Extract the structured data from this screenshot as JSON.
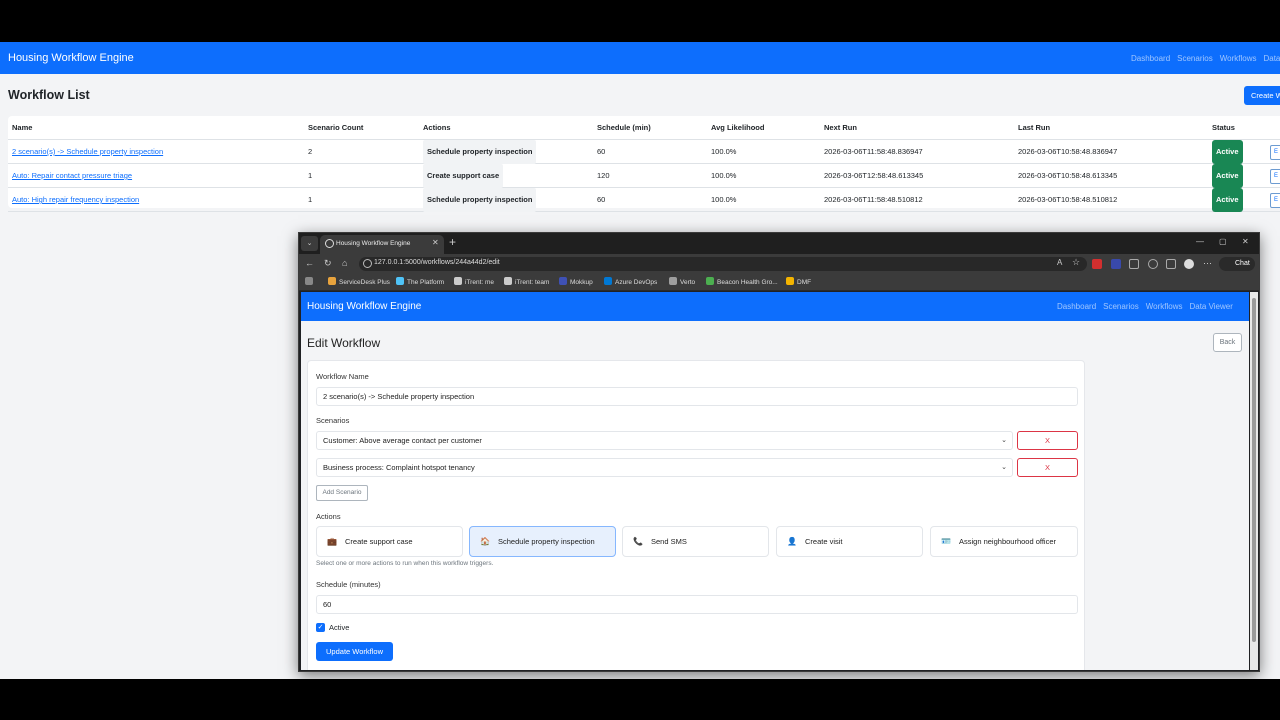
{
  "background_app": {
    "brand": "Housing Workflow Engine",
    "nav": [
      "Dashboard",
      "Scenarios",
      "Workflows",
      "Data"
    ],
    "title": "Workflow List",
    "create_button": "Create W",
    "table": {
      "headers": [
        "Name",
        "Scenario Count",
        "Actions",
        "Schedule (min)",
        "Avg Likelihood",
        "Next Run",
        "Last Run",
        "Status"
      ],
      "rows": [
        {
          "name": "2 scenario(s) -> Schedule property inspection",
          "scenario_count": "2",
          "action": "Schedule property inspection",
          "schedule": "60",
          "likelihood": "100.0%",
          "next_run": "2026-03-06T11:58:48.836947",
          "last_run": "2026-03-06T10:58:48.836947",
          "status": "Active",
          "edit": "E"
        },
        {
          "name": "Auto: Repair contact pressure triage",
          "scenario_count": "1",
          "action": "Create support case",
          "schedule": "120",
          "likelihood": "100.0%",
          "next_run": "2026-03-06T12:58:48.613345",
          "last_run": "2026-03-06T10:58:48.613345",
          "status": "Active",
          "edit": "E"
        },
        {
          "name": "Auto: High repair frequency inspection",
          "scenario_count": "1",
          "action": "Schedule property inspection",
          "schedule": "60",
          "likelihood": "100.0%",
          "next_run": "2026-03-06T11:58:48.510812",
          "last_run": "2026-03-06T10:58:48.510812",
          "status": "Active",
          "edit": "E"
        }
      ]
    }
  },
  "browser": {
    "tab_title": "Housing Workflow Engine",
    "url": "127.0.0.1:5000/workflows/244a44d2/edit",
    "chat_label": "Chat",
    "favorites": [
      {
        "label": "ServiceDesk Plus",
        "color": "#e8a33d"
      },
      {
        "label": "The Platform",
        "color": "#4fc3f7"
      },
      {
        "label": "iTrent: me",
        "color": "#cccccc"
      },
      {
        "label": "iTrent: team",
        "color": "#cccccc"
      },
      {
        "label": "Mokkup",
        "color": "#3f51b5"
      },
      {
        "label": "Azure DevOps",
        "color": "#0078d4"
      },
      {
        "label": "Verto",
        "color": "#9e9e9e"
      },
      {
        "label": "Beacon Health Gro...",
        "color": "#4caf50"
      },
      {
        "label": "DMF",
        "color": "#f4b400"
      }
    ]
  },
  "edit_page": {
    "brand": "Housing Workflow Engine",
    "nav": [
      "Dashboard",
      "Scenarios",
      "Workflows",
      "Data Viewer"
    ],
    "title": "Edit Workflow",
    "back_button": "Back",
    "workflow_name_label": "Workflow Name",
    "workflow_name_value": "2 scenario(s) -> Schedule property inspection",
    "scenarios_label": "Scenarios",
    "scenarios": [
      {
        "value": "Customer: Above average contact per customer",
        "remove": "X"
      },
      {
        "value": "Business process: Complaint hotspot tenancy",
        "remove": "X"
      }
    ],
    "add_scenario": "Add Scenario",
    "actions_label": "Actions",
    "actions": [
      {
        "label": "Create support case",
        "icon": "briefcase-icon",
        "glyph": "💼",
        "selected": false
      },
      {
        "label": "Schedule property inspection",
        "icon": "home-icon",
        "glyph": "🏠",
        "selected": true
      },
      {
        "label": "Send SMS",
        "icon": "phone-icon",
        "glyph": "📞",
        "selected": false
      },
      {
        "label": "Create visit",
        "icon": "user-icon",
        "glyph": "👤",
        "selected": false
      },
      {
        "label": "Assign neighbourhood officer",
        "icon": "badge-icon",
        "glyph": "🪪",
        "selected": false
      }
    ],
    "actions_help": "Select one or more actions to run when this workflow triggers.",
    "schedule_label": "Schedule (minutes)",
    "schedule_value": "60",
    "active_label": "Active",
    "active_checked": true,
    "update_button": "Update Workflow"
  }
}
